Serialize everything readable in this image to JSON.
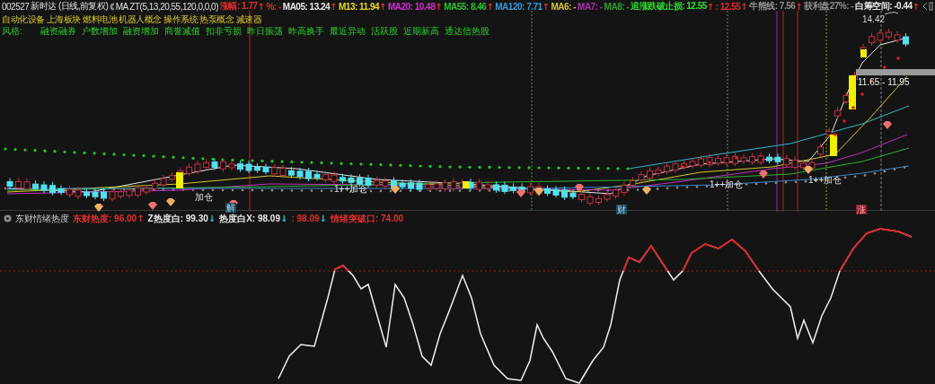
{
  "header": {
    "code": "002527",
    "name": "新时达",
    "period": "(日线,前复权)",
    "indicator": "MA ZT(5,13,20,55,120,0,0,0)",
    "readings": [
      {
        "label": "涨幅:",
        "value": "1.77",
        "arrow": "↑",
        "rising": true,
        "color": "#e03030"
      },
      {
        "label": "%:",
        "value": "-",
        "color": "#e03030"
      },
      {
        "label": "MA05:",
        "value": "13.24",
        "arrow": "↑",
        "rising": true,
        "color": "#e8e8e8"
      },
      {
        "label": "M13:",
        "value": "11.94",
        "arrow": "↑",
        "rising": true,
        "color": "#e8d82a"
      },
      {
        "label": "MA20:",
        "value": "10.48",
        "arrow": "↑",
        "rising": true,
        "color": "#d030d0"
      },
      {
        "label": "MA55:",
        "value": "8.46",
        "arrow": "↑",
        "rising": true,
        "color": "#30c030"
      },
      {
        "label": "MA120:",
        "value": "7.71",
        "arrow": "↑",
        "rising": true,
        "color": "#3a9ad8"
      },
      {
        "label": "MA6:",
        "value": "-",
        "color": "#d8c828"
      },
      {
        "label": "MA7:",
        "value": "-",
        "color": "#b030b0"
      },
      {
        "label": "MA8:",
        "value": "-",
        "color": "#30a030"
      },
      {
        "label": "追涨跌破止损:",
        "value": "12.55",
        "arrow": "↑",
        "rising": true,
        "color": "#30e030"
      },
      {
        "label": ":",
        "value": "12.55",
        "arrow": "↑",
        "rising": true,
        "color": "#e03030"
      },
      {
        "label": "牛熊线:",
        "value": "7.56",
        "arrow": "↑",
        "rising": true,
        "color": "#909090"
      },
      {
        "label": "获利盘27%:",
        "value": "-",
        "color": "#909090"
      },
      {
        "label": "白筹空间:",
        "value": "-0.44",
        "arrow": "↑",
        "rising": true,
        "color": "#e8e8e8"
      }
    ]
  },
  "concepts": "自动化设备 上海板块 燃料电池 机器人概念 操作系统 热泵概念 减速器",
  "style": {
    "label": "风格:",
    "tags": [
      "融资融券",
      "户数增加",
      "融资增加",
      "商誉减值",
      "扣非亏损",
      "昨日振荡",
      "昨高换手",
      "最近异动",
      "活跃股",
      "近期新高",
      "通达信热股"
    ]
  },
  "chart_labels": [
    {
      "text": "14.42",
      "kind": "price"
    },
    {
      "text": "11.65 - 11.95",
      "kind": "range"
    },
    {
      "text": "加仓",
      "kind": "signal"
    },
    {
      "text": "1++加仓",
      "kind": "signal"
    },
    {
      "text": "1++加仓",
      "kind": "signal"
    },
    {
      "text": "1++加仓",
      "kind": "signal"
    },
    {
      "text": "解",
      "kind": "marker"
    },
    {
      "text": "财",
      "kind": "marker"
    },
    {
      "text": "涨",
      "kind": "alert"
    }
  ],
  "lower_panel": {
    "title": "东财情绪热度",
    "readings": [
      {
        "label": "东财热度:",
        "value": "96.00",
        "arrow": "↑",
        "rising": true,
        "color": "#e03030"
      },
      {
        "label": "Z热度白:",
        "value": "99.30",
        "arrow": "↓",
        "rising": false,
        "color": "#e8e8e8"
      },
      {
        "label": "热度白X:",
        "value": "98.09",
        "arrow": "↓",
        "rising": false,
        "color": "#e8e8e8"
      },
      {
        "label": ":",
        "value": "98.09",
        "arrow": "↓",
        "rising": false,
        "color": "#e03030"
      },
      {
        "label": "情绪突破口:",
        "value": "74.00",
        "color": "#e03030"
      }
    ]
  }
}
